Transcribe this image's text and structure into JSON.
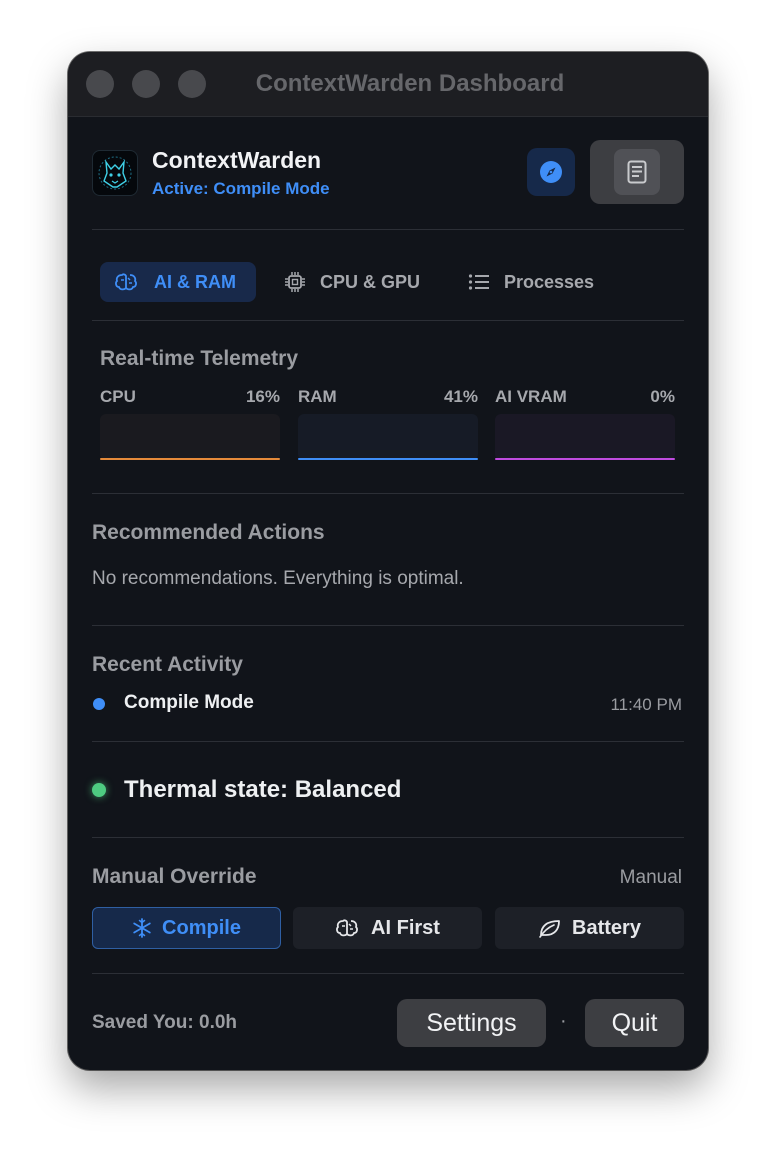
{
  "window": {
    "title": "ContextWarden Dashboard"
  },
  "header": {
    "app_name": "ContextWarden",
    "status": "Active: Compile Mode",
    "compass_icon": "compass-icon",
    "document_icon": "document-icon"
  },
  "tabs": [
    {
      "label": "AI & RAM",
      "icon": "brain-icon",
      "active": true
    },
    {
      "label": "CPU & GPU",
      "icon": "chip-icon",
      "active": false
    },
    {
      "label": "Processes",
      "icon": "list-icon",
      "active": false
    }
  ],
  "telemetry": {
    "title": "Real-time Telemetry",
    "meters": [
      {
        "label": "CPU",
        "value": "16%",
        "level": 0.16,
        "color": "#e58a3a"
      },
      {
        "label": "RAM",
        "value": "41%",
        "level": 0.41,
        "color": "#3f8ef7"
      },
      {
        "label": "AI VRAM",
        "value": "0%",
        "level": 0.0,
        "color": "#c04be0"
      }
    ]
  },
  "recommendations": {
    "title": "Recommended Actions",
    "message": "No recommendations. Everything is optimal."
  },
  "activity": {
    "title": "Recent Activity",
    "items": [
      {
        "label": "Compile Mode",
        "time": "11:40 PM"
      }
    ]
  },
  "thermal": {
    "label": "Thermal state: Balanced",
    "color": "#4ecb81"
  },
  "override": {
    "title": "Manual Override",
    "mode": "Manual",
    "buttons": [
      {
        "label": "Compile",
        "icon": "snowflake-icon",
        "active": true
      },
      {
        "label": "AI First",
        "icon": "brain-icon",
        "active": false
      },
      {
        "label": "Battery",
        "icon": "leaf-icon",
        "active": false
      }
    ]
  },
  "footer": {
    "saved": "Saved You: 0.0h",
    "settings_label": "Settings",
    "separator": "·",
    "quit_label": "Quit"
  },
  "colors": {
    "accent": "#3f8ef7",
    "background": "#11141a"
  }
}
